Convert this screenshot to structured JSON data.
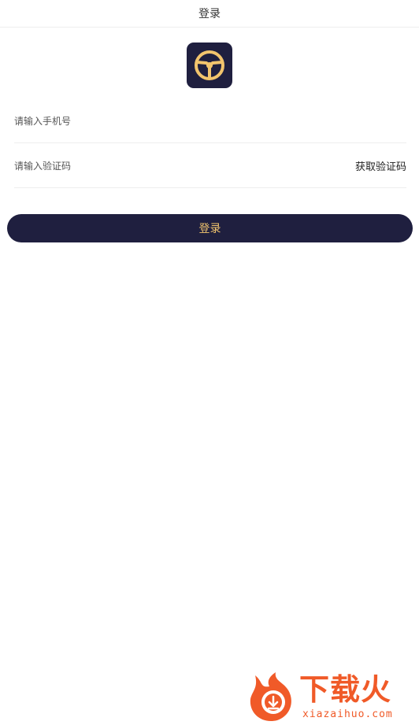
{
  "header": {
    "title": "登录"
  },
  "logo": {
    "icon": "steering-wheel-icon",
    "background": "#1f1f3f",
    "accent": "#f2c46d"
  },
  "form": {
    "phone_placeholder": "请输入手机号",
    "code_placeholder": "请输入验证码",
    "get_code_label": "获取验证码"
  },
  "login_button": {
    "label": "登录",
    "background": "#1f1f3f",
    "text_color": "#f2c46d"
  },
  "watermark": {
    "title": "下载火",
    "domain": "xiazaihuo.com",
    "color": "#f05a28"
  }
}
